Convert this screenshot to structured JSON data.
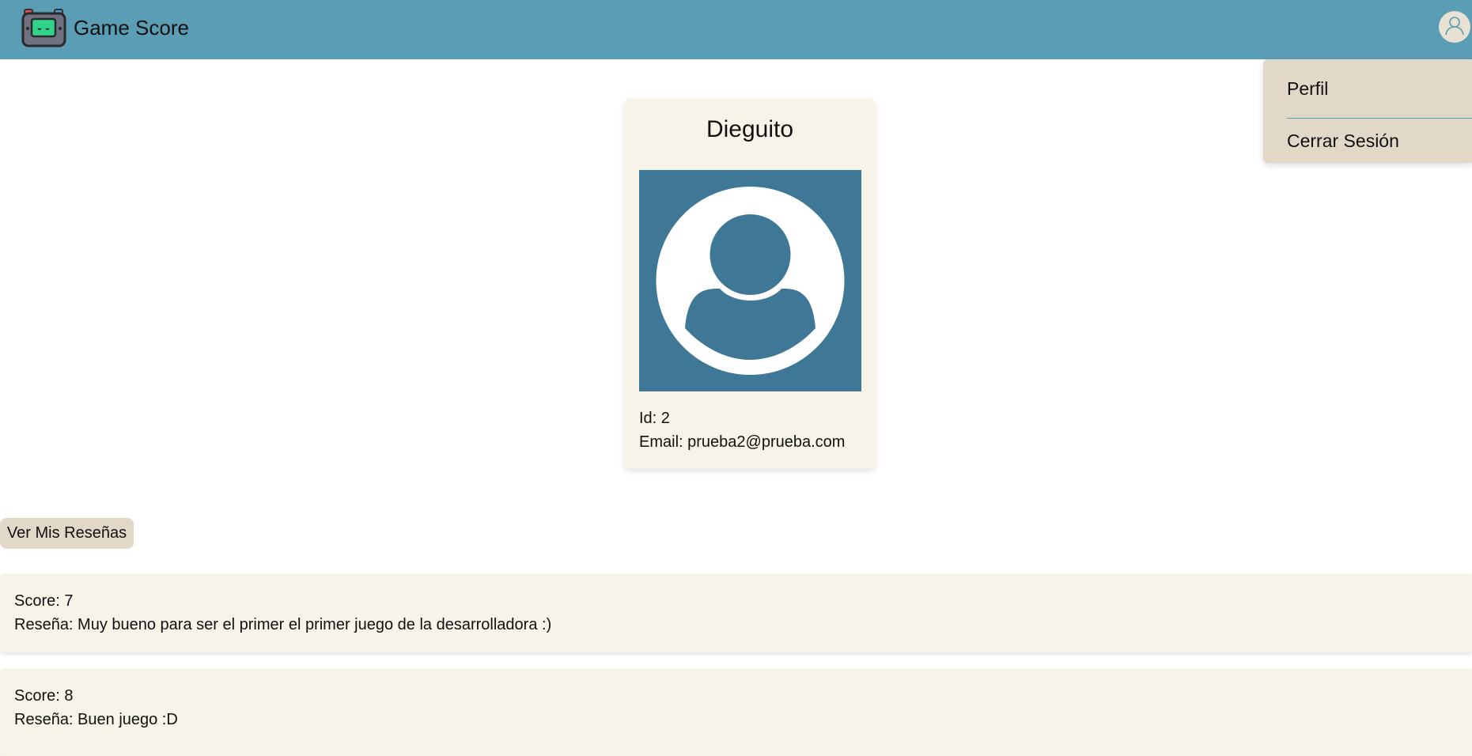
{
  "navbar": {
    "brand": "Game Score",
    "logo_icon": "game-console-icon",
    "user_icon": "user-icon",
    "color": "#5a9db4"
  },
  "dropdown": {
    "items": [
      {
        "label": "Perfil"
      },
      {
        "label": "Cerrar Sesión"
      }
    ]
  },
  "profile": {
    "name": "Dieguito",
    "avatar_icon": "user-placeholder-icon",
    "id_text": "Id: 2",
    "email_text": "Email: prueba2@prueba.com"
  },
  "reviews_button": {
    "label": "Ver Mis Reseñas"
  },
  "reviews": [
    {
      "score": "Score: 7",
      "text": "Reseña: Muy bueno para ser el primer el primer juego de la desarrolladora :)"
    },
    {
      "score": "Score: 8",
      "text": "Reseña: Buen juego :D"
    }
  ],
  "colors": {
    "navbar": "#5a9db4",
    "card_bg": "#f7f3e8",
    "button_bg": "#e2d8c7",
    "avatar_bg": "#3e7896"
  }
}
